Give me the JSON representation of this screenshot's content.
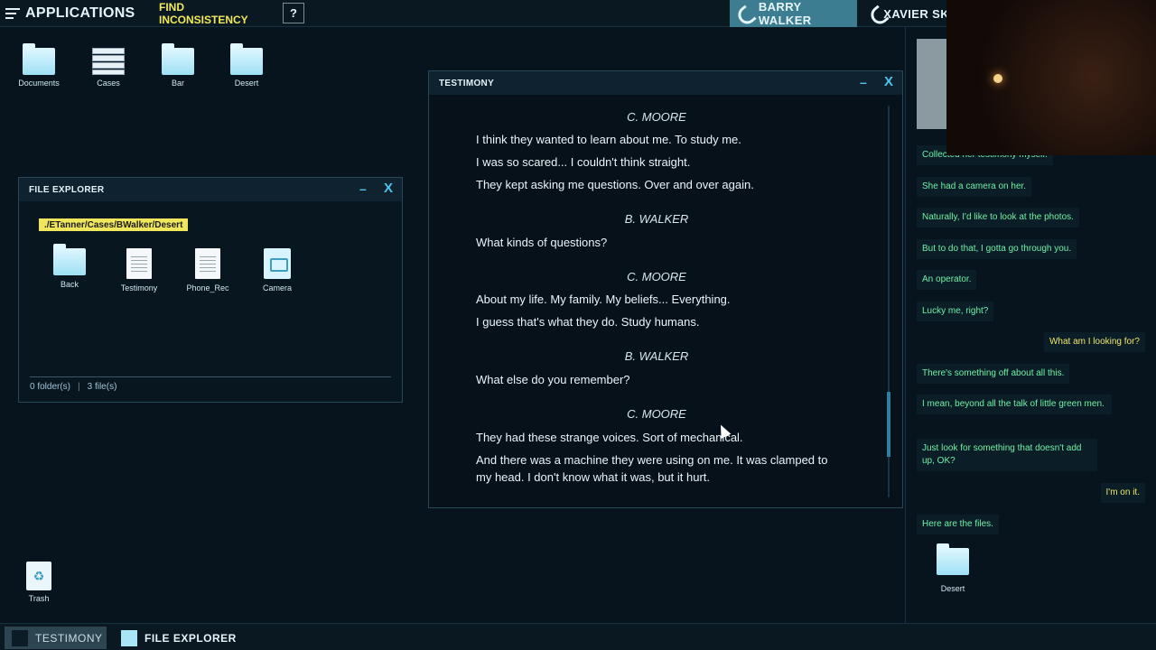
{
  "topbar": {
    "apps_label": "APPLICATIONS",
    "find_label": "FIND INCONSISTENCY",
    "help_label": "?",
    "contacts": [
      {
        "name": "BARRY WALKER"
      },
      {
        "name": "XAVIER SKI"
      }
    ]
  },
  "desktop": {
    "icons": [
      {
        "label": "Documents"
      },
      {
        "label": "Cases"
      },
      {
        "label": "Bar"
      },
      {
        "label": "Desert"
      }
    ],
    "trash_label": "Trash"
  },
  "file_explorer": {
    "title": "FILE EXPLORER",
    "path": "./ETanner/Cases/BWalker/Desert",
    "items": [
      {
        "label": "Back",
        "icon": "folder-back-icon"
      },
      {
        "label": "Testimony",
        "icon": "document-icon"
      },
      {
        "label": "Phone_Rec",
        "icon": "document-icon"
      },
      {
        "label": "Camera",
        "icon": "camera-icon"
      }
    ],
    "folders_count": "0 folder(s)",
    "files_count": "3 file(s)"
  },
  "testimony": {
    "title": "TESTIMONY",
    "blocks": [
      {
        "speaker": "C. MOORE",
        "lines": [
          "I think they wanted to learn about me. To study me.",
          "I was so scared... I couldn't think straight.",
          "They kept asking me questions. Over and over again."
        ]
      },
      {
        "speaker": "B. WALKER",
        "lines": [
          "What kinds of questions?"
        ]
      },
      {
        "speaker": "C. MOORE",
        "lines": [
          "About my life. My family. My beliefs... Everything.",
          "I guess that's what they do. Study humans."
        ]
      },
      {
        "speaker": "B. WALKER",
        "lines": [
          "What else do you remember?"
        ]
      },
      {
        "speaker": "C. MOORE",
        "lines": [
          "They had these strange voices. Sort of mechanical.",
          "And there was a machine they were using on me. It was clamped to my head. I don't know what it was, but it hurt."
        ]
      }
    ]
  },
  "chat": {
    "messages": [
      {
        "from": "them",
        "text": "Collected her testimony myself."
      },
      {
        "from": "them",
        "text": "She had a camera on her."
      },
      {
        "from": "them",
        "text": "Naturally, I'd like to look at the photos."
      },
      {
        "from": "them",
        "text": "But to do that, I gotta go through you."
      },
      {
        "from": "them",
        "text": "An operator."
      },
      {
        "from": "them",
        "text": "Lucky me, right?"
      },
      {
        "from": "me",
        "text": "What am I looking for?"
      },
      {
        "from": "them",
        "text": "There's something off about all this."
      },
      {
        "from": "them",
        "text": "I mean, beyond all the talk of little green men."
      },
      {
        "from": "them",
        "text": "Just look for something that doesn't add up, OK?"
      },
      {
        "from": "me",
        "text": "I'm on it."
      },
      {
        "from": "them",
        "text": "Here are the files."
      }
    ],
    "attachment_label": "Desert"
  },
  "taskbar": {
    "tasks": [
      {
        "label": "TESTIMONY"
      },
      {
        "label": "FILE EXPLORER"
      }
    ]
  },
  "colors": {
    "accent": "#4ec5ee",
    "path_tag": "#f0e65b",
    "chat_them": "#6ff2a6",
    "chat_me": "#f1e66a",
    "active_contact": "#3d7d92"
  }
}
